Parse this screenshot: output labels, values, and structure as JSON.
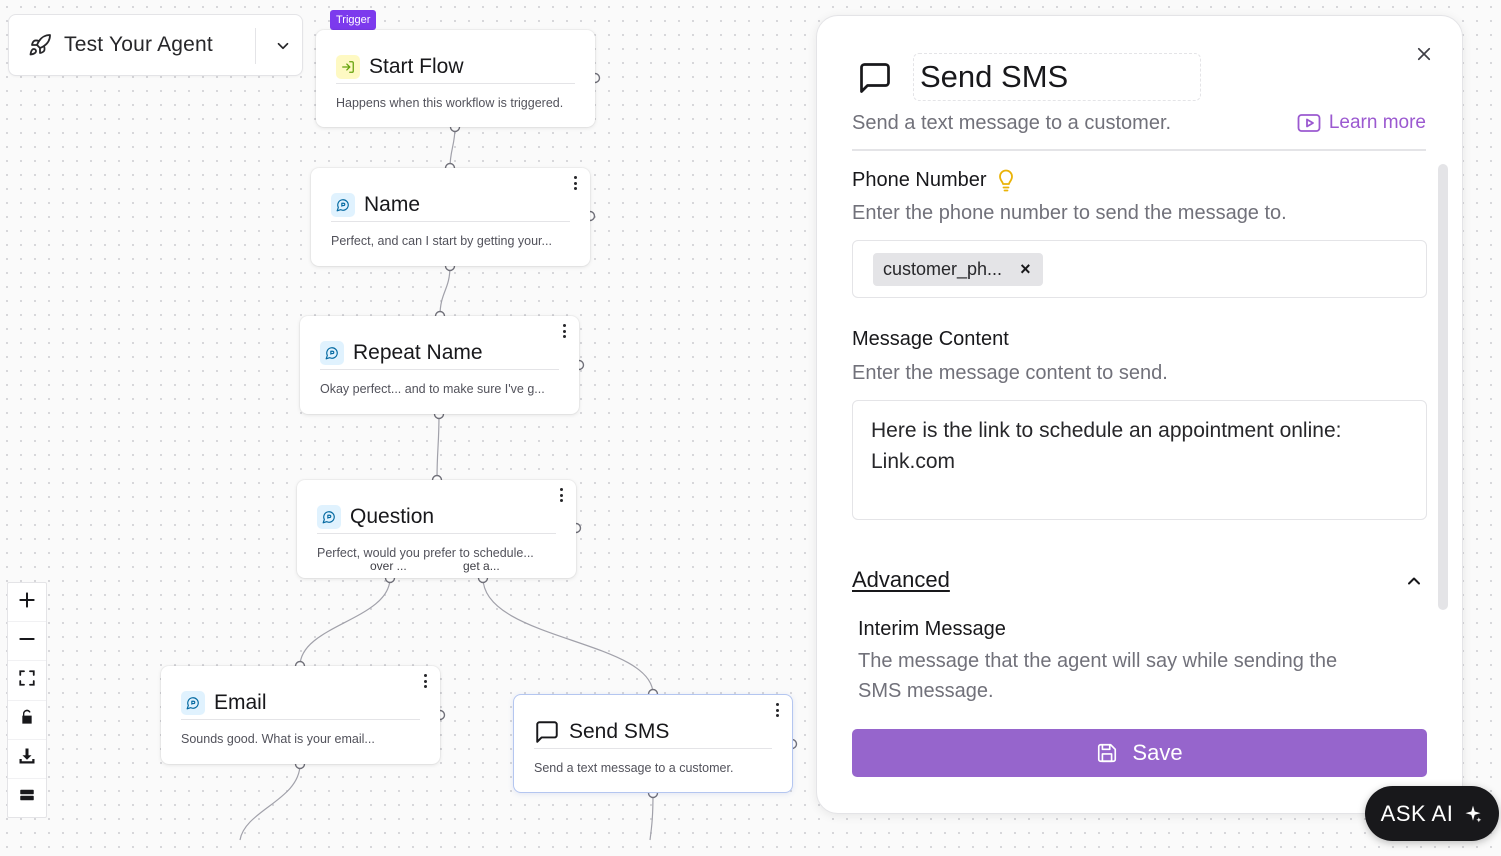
{
  "agent_selector": {
    "label": "Test Your Agent"
  },
  "trigger_badge": "Trigger",
  "nodes": {
    "start": {
      "title": "Start Flow",
      "desc": "Happens when this workflow is triggered."
    },
    "name": {
      "title": "Name",
      "desc": "Perfect, and can I start by getting your..."
    },
    "repeat_name": {
      "title": "Repeat Name",
      "desc": "Okay perfect... and to make sure I've g..."
    },
    "question": {
      "title": "Question",
      "desc": "Perfect, would you prefer to schedule...",
      "branch_left": "over ...",
      "branch_right": "get a..."
    },
    "email": {
      "title": "Email",
      "desc": "Sounds good. What is your email..."
    },
    "send_sms": {
      "title": "Send SMS",
      "desc": "Send a text message to a customer."
    }
  },
  "toolbar": [
    "zoom-in",
    "zoom-out",
    "fit-view",
    "lock",
    "download",
    "minimap"
  ],
  "panel": {
    "title": "Send SMS",
    "subtitle": "Send a text message to a customer.",
    "learn_more": "Learn more",
    "phone_label": "Phone Number",
    "phone_help": "Enter the phone number to send the message to.",
    "phone_chip": "customer_ph...",
    "phone_chip_remove": "×",
    "message_label": "Message Content",
    "message_help": "Enter the message content to send.",
    "message_line1": "Here is the link to schedule an appointment online:",
    "message_line2": "Link.com",
    "advanced_label": "Advanced",
    "interim_label": "Interim Message",
    "interim_help_line1": "The message that the agent will say while sending the",
    "interim_help_line2": "SMS message.",
    "save_label": "Save"
  },
  "ask_ai": {
    "label": "ASK AI"
  },
  "colors": {
    "accent": "#9665cc",
    "trigger": "#7c3aed",
    "learn_more": "#9b59d0"
  }
}
